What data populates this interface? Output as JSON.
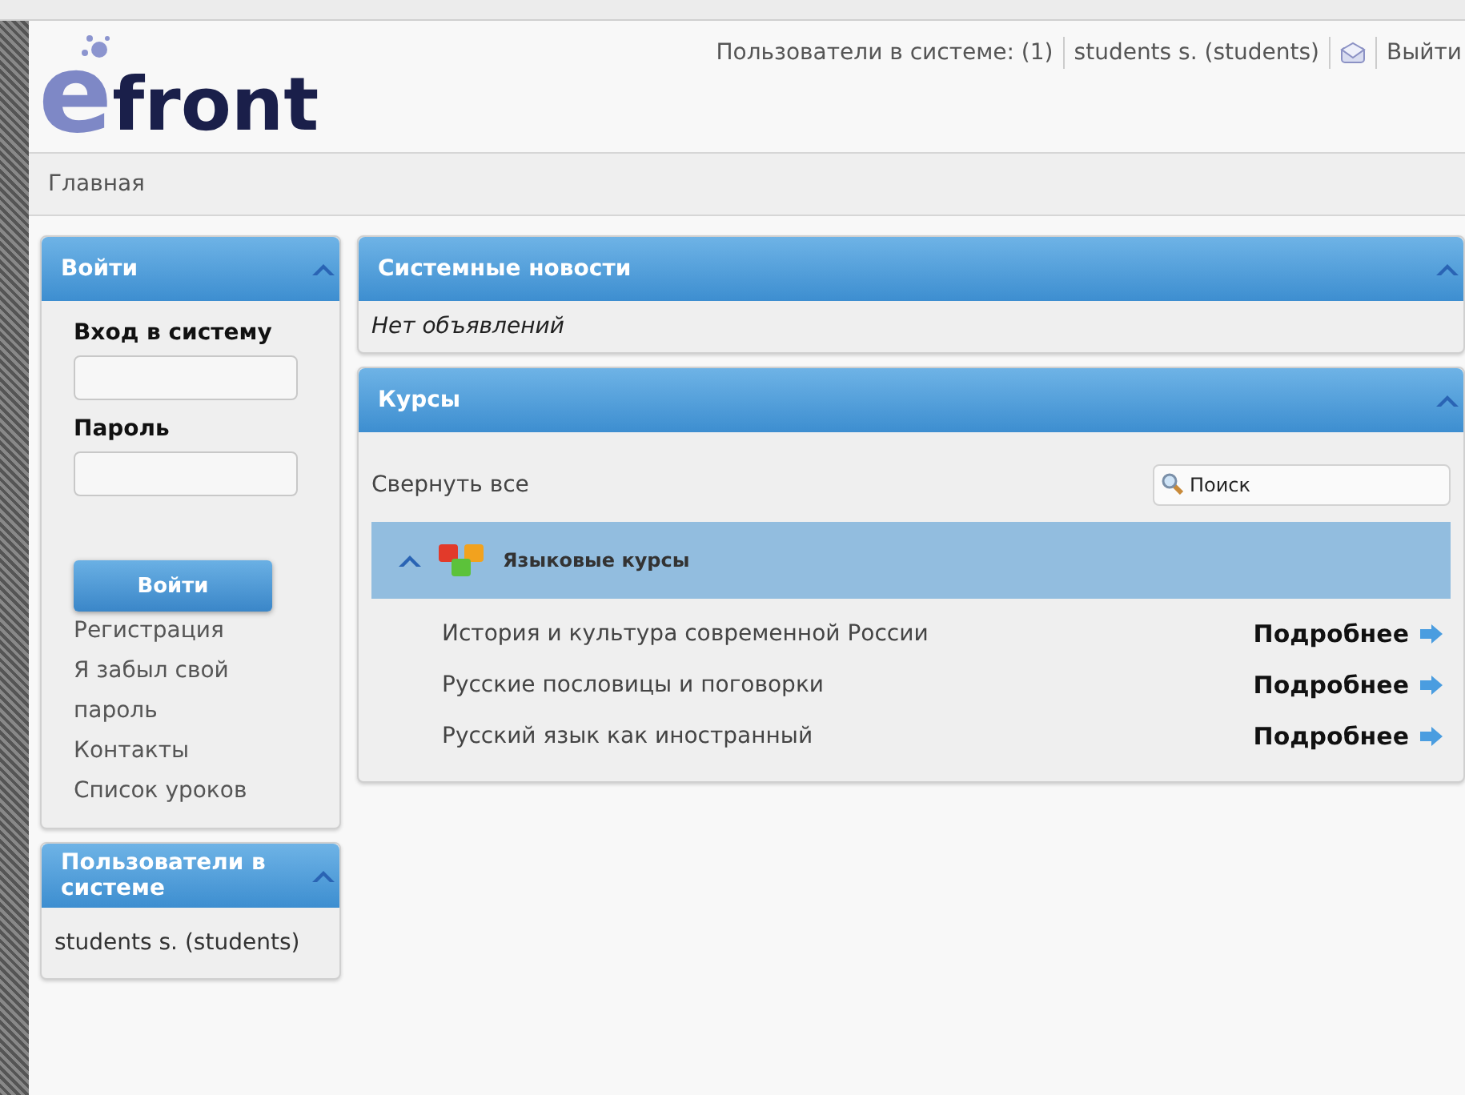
{
  "header": {
    "logo": {
      "mark": "e",
      "text": "front"
    },
    "online_link": "Пользователи в системе: (1)",
    "user_link": "students s. (students)",
    "logout": "Выйти"
  },
  "breadcrumb": "Главная",
  "login_panel": {
    "title": "Войти",
    "expanded": true,
    "login_label": "Вход в систему",
    "password_label": "Пароль",
    "submit": "Войти",
    "links": [
      "Регистрация",
      "Я забыл свой пароль",
      "Контакты",
      "Список уроков"
    ]
  },
  "online_panel": {
    "title": "Пользователи в системе",
    "expanded": true,
    "users": [
      "students s. (students)"
    ]
  },
  "news_panel": {
    "title": "Системные новости",
    "expanded": true,
    "empty_text": "Нет объявлений"
  },
  "courses_panel": {
    "title": "Курсы",
    "expanded": true,
    "collapse_all": "Свернуть все",
    "search": {
      "placeholder": "Поиск"
    },
    "categories": [
      {
        "name": "Языковые курсы",
        "expanded": true,
        "courses": [
          {
            "name": "История и культура современной России",
            "more": "Подробнее"
          },
          {
            "name": "Русские пословицы и поговорки",
            "more": "Подробнее"
          },
          {
            "name": "Русский язык как иностранный",
            "more": "Подробнее"
          }
        ]
      }
    ]
  }
}
